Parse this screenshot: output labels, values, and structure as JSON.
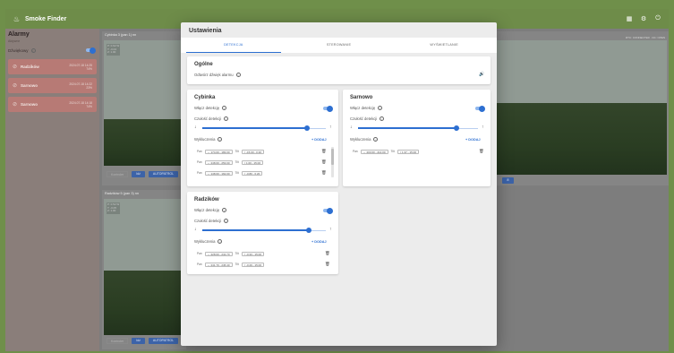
{
  "app": {
    "title": "Smoke Finder",
    "actions": [
      "grid-icon",
      "gear-icon",
      "power-icon"
    ]
  },
  "sidebar": {
    "title": "Alarmy",
    "subtitle": "Aktywne",
    "notifications_label": "Dźwiękowy",
    "alerts": [
      {
        "name": "Radzików",
        "date": "2024.07.18 14:25",
        "pct": "74%"
      },
      {
        "name": "Sarnowo",
        "date": "2024.07.18 14:22",
        "pct": "23%"
      },
      {
        "name": "Sarnowo",
        "date": "2024.07.18 14:18",
        "pct": "74%"
      }
    ]
  },
  "cameras": [
    {
      "title": "Cybinka 3 (pan 1) nn",
      "overlay": [
        "P: 0.62 W",
        "T: -0.04",
        "Z: 1.00"
      ],
      "footer": [
        "Kontroler",
        "Idź",
        "AUTOPATROL"
      ]
    },
    {
      "title": "Radzików 5 (pan 3) nn",
      "overlay": [
        "P: 0.52 W",
        "T: -0.05",
        "Z: 1.00"
      ],
      "footer": [
        "Kontroler",
        "Idź",
        "AUTOPATROL"
      ]
    }
  ],
  "status_strip": "RTC: CONNECTED · DC: OPEN",
  "dialog": {
    "title": "Ustawienia",
    "tabs": [
      "DETEKCJA",
      "STEROWANIE",
      "WYŚWIETLANIE"
    ],
    "active_tab": 0,
    "general": {
      "title": "Ogólne",
      "sound_label": "Odtwórz dźwięk alarmu"
    },
    "labels": {
      "enable": "Włącz detekcję",
      "sensitivity": "Czułość detekcji",
      "exclusions": "Wykluczenia",
      "add": "+ DODAJ",
      "pan": "Pan",
      "tilt": "Tilt"
    },
    "cameras": [
      {
        "name": "Cybinka",
        "enabled": true,
        "sensitivity": 0.85,
        "exclusions": [
          {
            "pan": "↔ 174.00 - 183.00",
            "tilt": "↕ -15.00 - 0.30"
          },
          {
            "pan": "↔ 248.00 - 253.00",
            "tilt": "↕ 1.00 - 15.00"
          },
          {
            "pan": "↔ 148.00 - 162.00",
            "tilt": "↕ -0.80 - 0.20"
          }
        ]
      },
      {
        "name": "Sarnowo",
        "enabled": true,
        "sensitivity": 0.82,
        "exclusions": [
          {
            "pan": "↔ 203.00 - 214.00",
            "tilt": "↕ 1.37 - 15.00"
          }
        ]
      },
      {
        "name": "Radzików",
        "enabled": true,
        "sensitivity": 0.86,
        "exclusions": [
          {
            "pan": "↔ 228.00 - 241.70",
            "tilt": "↕ -0.33 - 15.00"
          },
          {
            "pan": "↔ 241.70 - 245.40",
            "tilt": "↕ -0.29 - 15.00"
          }
        ]
      }
    ]
  }
}
